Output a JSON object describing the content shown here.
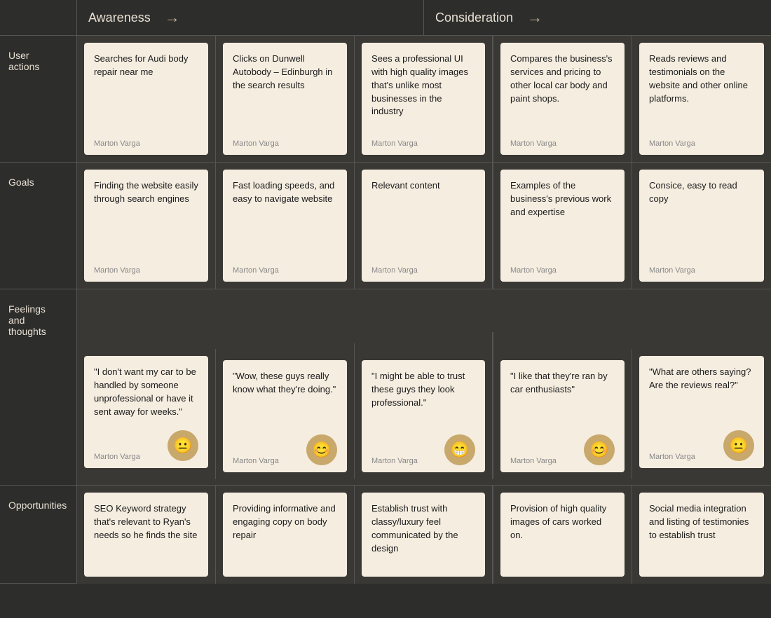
{
  "header": {
    "corner": "",
    "sections": [
      {
        "title": "Awareness",
        "arrow": "→"
      },
      {
        "title": "Consideration",
        "arrow": "→"
      }
    ]
  },
  "rows": [
    {
      "label": "User\nactions",
      "cards": [
        {
          "text": "Searches for Audi body repair near me",
          "author": "Marton Varga"
        },
        {
          "text": "Clicks on Dunwell Autobody – Edinburgh in the search results",
          "author": "Marton Varga"
        },
        {
          "text": "Sees a professional UI with high quality images that's unlike most businesses in the industry",
          "author": "Marton Varga"
        },
        {
          "text": "Compares the business's services and pricing to other local car body and paint shops.",
          "author": "Marton Varga"
        },
        {
          "text": "Reads reviews and testimonials on the website and other online platforms.",
          "author": "Marton Varga"
        }
      ]
    },
    {
      "label": "Goals",
      "cards": [
        {
          "text": "Finding the website easily through search engines",
          "author": "Marton Varga"
        },
        {
          "text": "Fast loading speeds, and easy to navigate website",
          "author": "Marton Varga"
        },
        {
          "text": "Relevant content",
          "author": "Marton Varga"
        },
        {
          "text": "Examples of the business's previous work and expertise",
          "author": "Marton Varga"
        },
        {
          "text": "Consice, easy to read copy",
          "author": "Marton Varga"
        }
      ]
    },
    {
      "label": "Feelings\nand\nthoughts",
      "cards": [
        {
          "text": "\"I don't want my car to be handled by someone unprofessional or have it sent away for weeks.\"",
          "author": "Marton Varga",
          "emoji": "neutral"
        },
        {
          "text": "\"Wow, these guys really know what they're doing.\"",
          "author": "Marton Varga",
          "emoji": "happy"
        },
        {
          "text": "\"I might be able to trust these guys they look professional.\"",
          "author": "Marton Varga",
          "emoji": "grin"
        },
        {
          "text": "\"I like that they're ran by car enthusiasts\"",
          "author": "Marton Varga",
          "emoji": "happy"
        },
        {
          "text": "\"What are others saying? Are the reviews real?\"",
          "author": "Marton Varga",
          "emoji": "neutral"
        }
      ]
    },
    {
      "label": "Opportunities",
      "cards": [
        {
          "text": "SEO Keyword strategy that's relevant to Ryan's needs so he finds the site",
          "author": ""
        },
        {
          "text": "Providing informative and engaging copy on body repair",
          "author": ""
        },
        {
          "text": "Establish trust with classy/luxury feel communicated by the design",
          "author": ""
        },
        {
          "text": "Provision of high quality images of cars worked on.",
          "author": ""
        },
        {
          "text": "Social media integration and listing of testimonies to establish trust",
          "author": ""
        }
      ]
    }
  ]
}
